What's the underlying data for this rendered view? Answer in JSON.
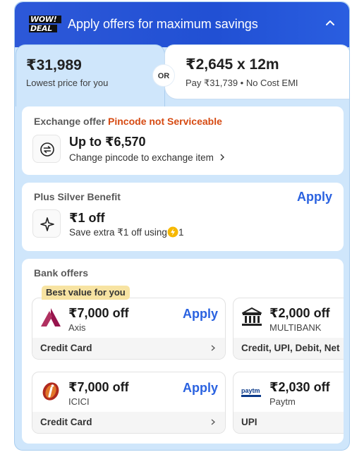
{
  "header": {
    "badge_line1": "WOW!",
    "badge_line2": "DEAL",
    "title": "Apply offers for maximum savings",
    "collapse_icon": "chevron-up-icon"
  },
  "pricing": {
    "left_price": "₹31,989",
    "left_label": "Lowest price for you",
    "or_label": "OR",
    "right_price": "₹2,645 x 12m",
    "right_label": "Pay ₹31,739 • No Cost EMI"
  },
  "exchange": {
    "title": "Exchange offer",
    "status": "Pincode not Serviceable",
    "amount": "Up to ₹6,570",
    "action": "Change pincode to exchange item",
    "icon": "exchange-icon"
  },
  "plus": {
    "title": "Plus Silver Benefit",
    "apply_label": "Apply",
    "amount": "₹1 off",
    "detail_prefix": "Save extra ₹1 off using",
    "detail_suffix": "1",
    "icon": "plus-benefit-icon",
    "coin_icon": "supercoin-icon"
  },
  "bank": {
    "title": "Bank offers",
    "best_badge": "Best value for you",
    "offers": [
      {
        "amount": "₹7,000 off",
        "bank": "Axis",
        "apply": "Apply",
        "method": "Credit Card",
        "logo": "axis-bank-logo"
      },
      {
        "amount": "₹2,000 off",
        "bank": "MULTIBANK",
        "apply": "",
        "method": "Credit, UPI, Debit, Net",
        "logo": "bank-building-icon"
      },
      {
        "amount": "₹7,000 off",
        "bank": "ICICI",
        "apply": "Apply",
        "method": "Credit Card",
        "logo": "icici-bank-logo"
      },
      {
        "amount": "₹2,030 off",
        "bank": "Paytm",
        "apply": "",
        "method": "UPI",
        "logo": "paytm-logo",
        "logo_text": "paytm"
      }
    ]
  },
  "colors": {
    "header_blue": "#2150d4",
    "panel_blue": "#cfe6fb",
    "apply_blue": "#2a62e0",
    "warning_orange": "#d64a12",
    "badge_yellow": "#f7e3a2"
  }
}
